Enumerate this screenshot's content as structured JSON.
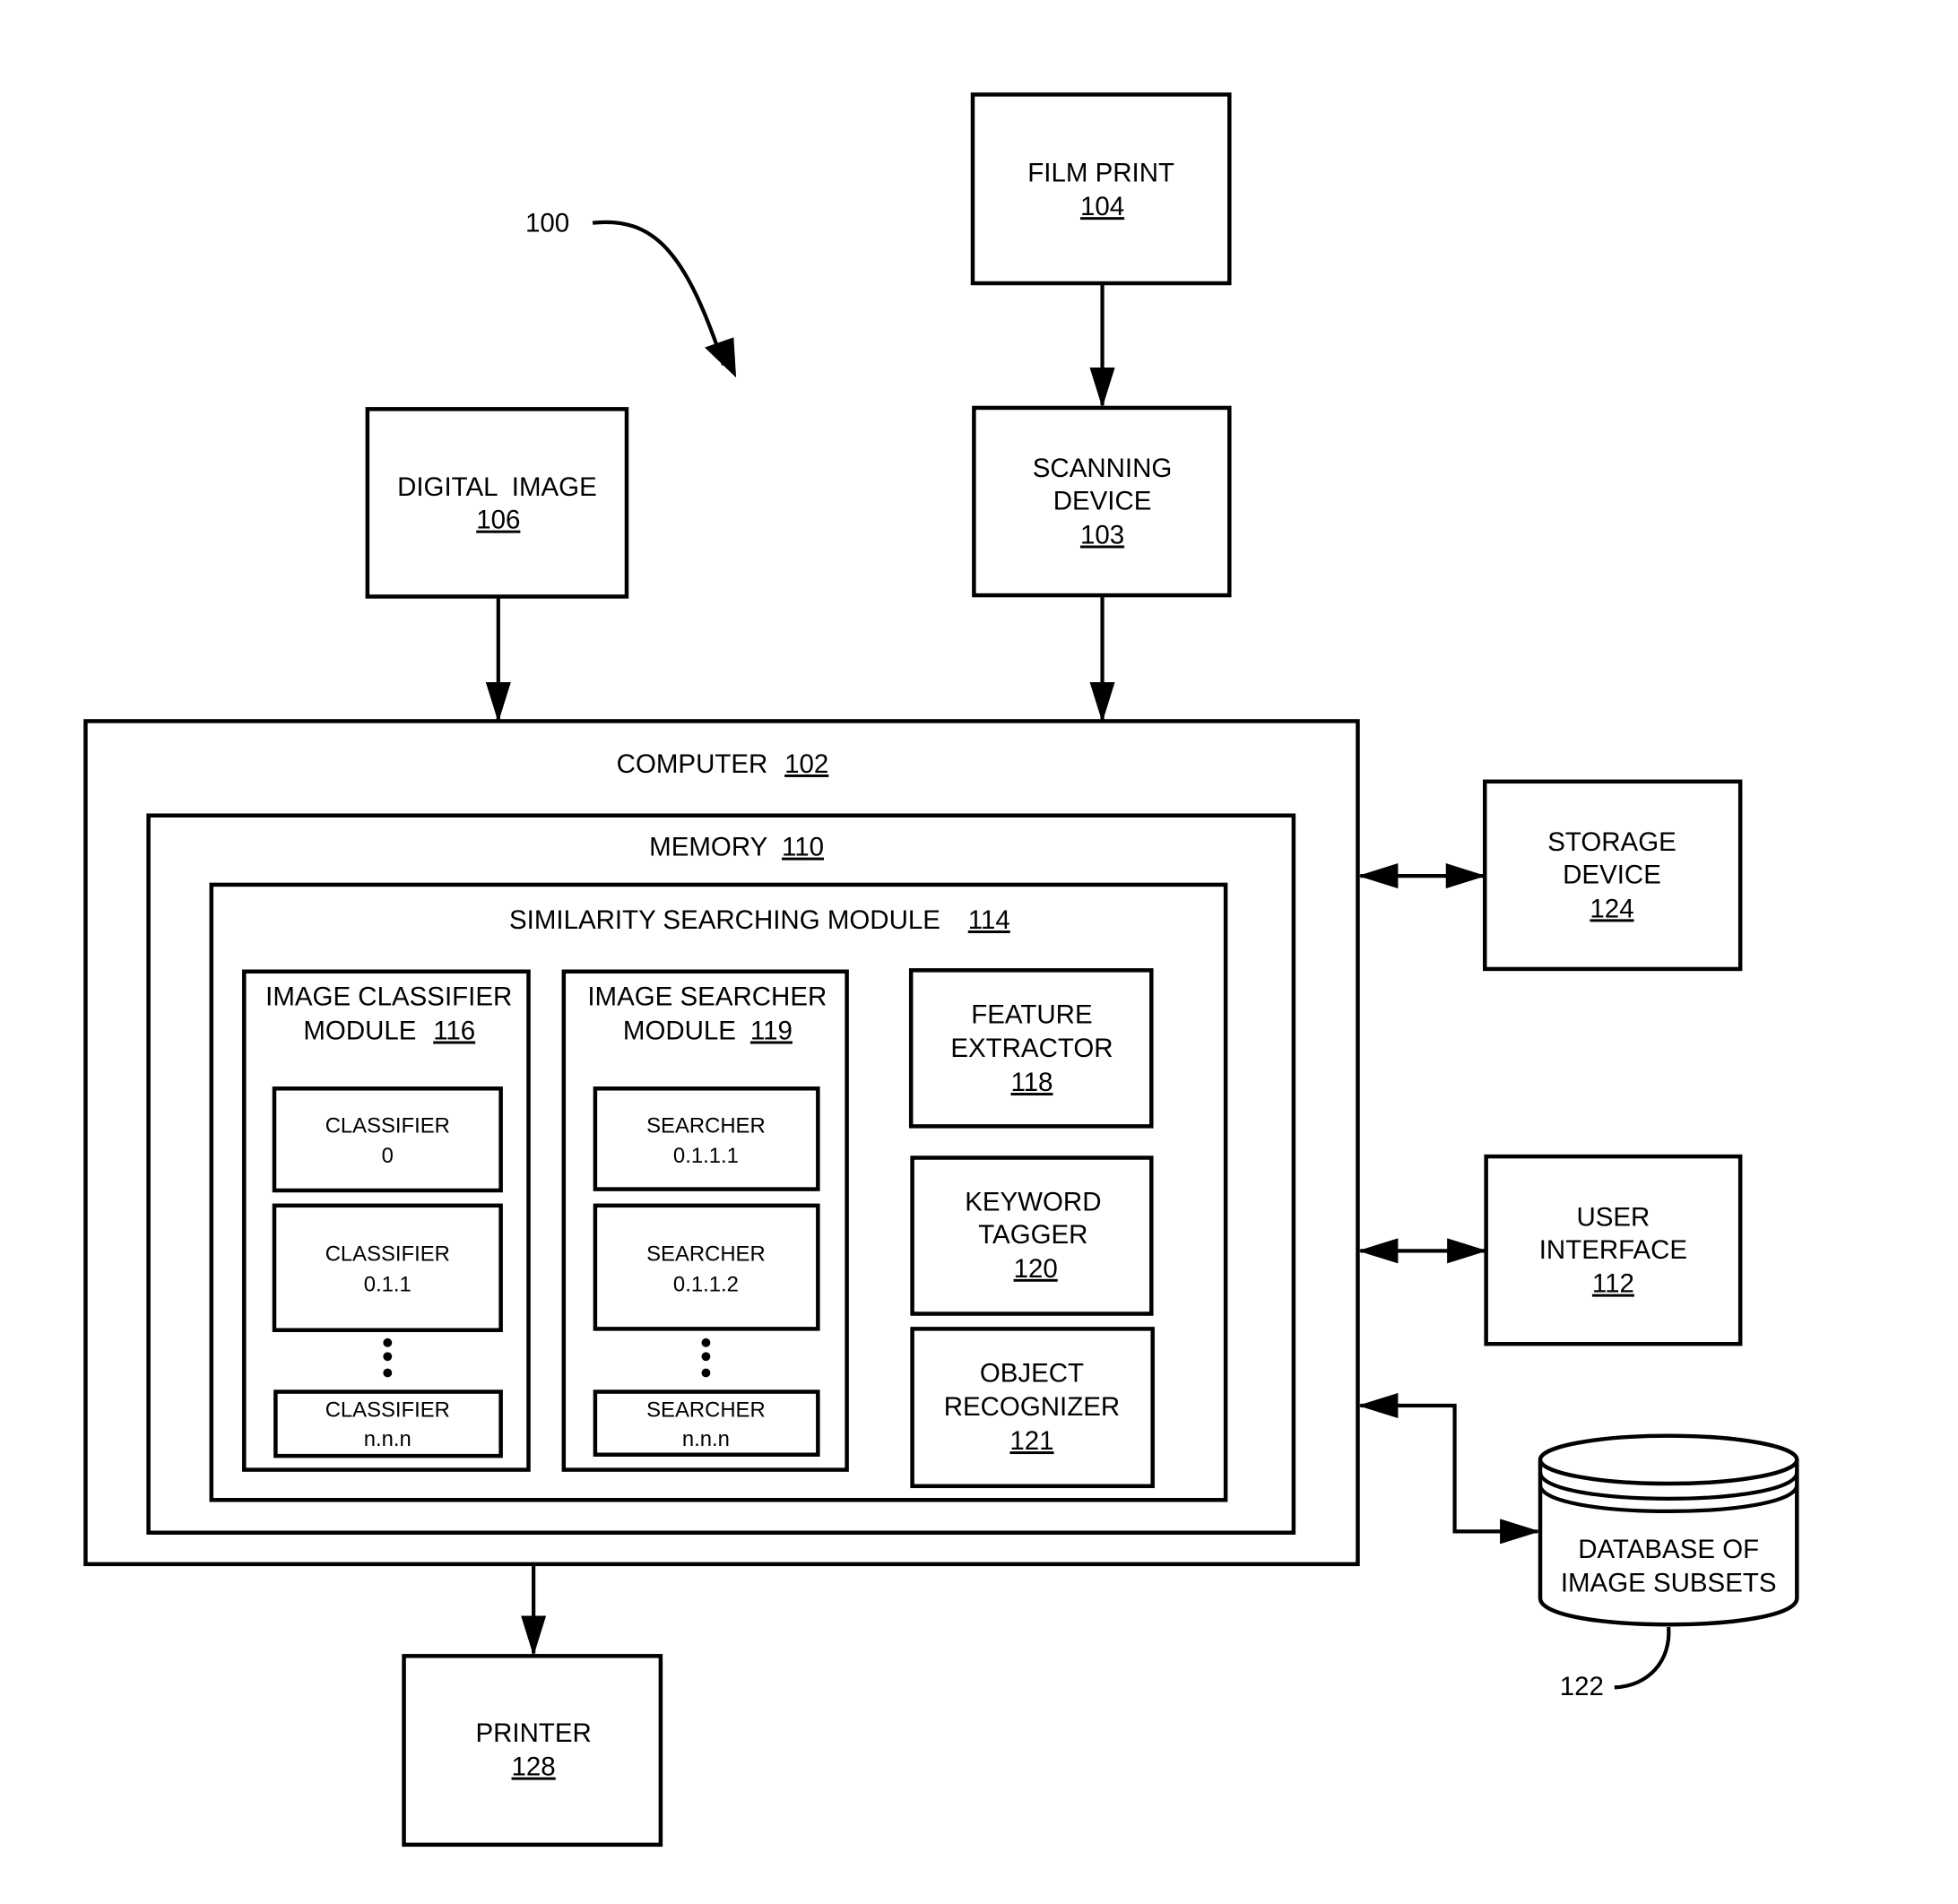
{
  "figure": {
    "reference_label": "100",
    "nodes": {
      "film_print": {
        "title": "FILM PRINT",
        "ref": "104"
      },
      "scanning_device": {
        "title_lines": [
          "SCANNING",
          "DEVICE"
        ],
        "ref": "103"
      },
      "digital_image": {
        "title": "DIGITAL  IMAGE",
        "ref": "106"
      },
      "computer": {
        "title": "COMPUTER",
        "ref": "102"
      },
      "memory": {
        "title": "MEMORY",
        "ref": "110"
      },
      "similarity_module": {
        "title": "SIMILARITY SEARCHING MODULE",
        "ref": "114"
      },
      "classifier_module": {
        "title_lines": [
          "IMAGE CLASSIFIER",
          "MODULE"
        ],
        "ref": "116",
        "items": [
          {
            "title": "CLASSIFIER",
            "id": "0"
          },
          {
            "title": "CLASSIFIER",
            "id": "0.1.1"
          },
          {
            "title": "CLASSIFIER",
            "id": "n.n.n"
          }
        ]
      },
      "searcher_module": {
        "title_lines": [
          "IMAGE SEARCHER",
          "MODULE"
        ],
        "ref": "119",
        "items": [
          {
            "title": "SEARCHER",
            "id": "0.1.1.1"
          },
          {
            "title": "SEARCHER",
            "id": "0.1.1.2"
          },
          {
            "title": "SEARCHER",
            "id": "n.n.n"
          }
        ]
      },
      "feature_extractor": {
        "title_lines": [
          "FEATURE",
          "EXTRACTOR"
        ],
        "ref": "118"
      },
      "keyword_tagger": {
        "title_lines": [
          "KEYWORD",
          "TAGGER"
        ],
        "ref": "120"
      },
      "object_recognizer": {
        "title_lines": [
          "OBJECT",
          "RECOGNIZER"
        ],
        "ref": "121"
      },
      "storage_device": {
        "title_lines": [
          "STORAGE",
          "DEVICE"
        ],
        "ref": "124"
      },
      "user_interface": {
        "title_lines": [
          "USER",
          "INTERFACE"
        ],
        "ref": "112"
      },
      "database": {
        "title_lines": [
          "DATABASE OF",
          "IMAGE SUBSETS"
        ],
        "ref": "122"
      },
      "printer": {
        "title": "PRINTER",
        "ref": "128"
      }
    }
  }
}
